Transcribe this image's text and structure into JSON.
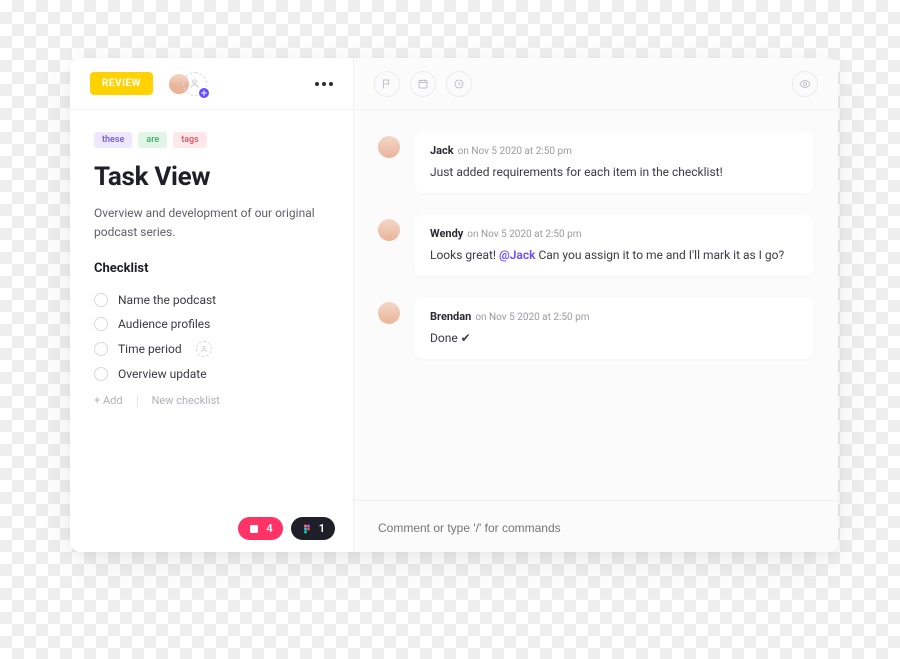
{
  "status_badge": "REVIEW",
  "tags": [
    {
      "label": "these",
      "bg": "#ede7ff",
      "fg": "#7a63d6"
    },
    {
      "label": "are",
      "bg": "#e2f6e8",
      "fg": "#4caf7a"
    },
    {
      "label": "tags",
      "bg": "#ffe7ea",
      "fg": "#e55a6a"
    }
  ],
  "title": "Task View",
  "description": "Overview and development of our original podcast series.",
  "checklist": {
    "heading": "Checklist",
    "items": [
      {
        "label": "Name the podcast",
        "hint_person": false
      },
      {
        "label": "Audience profiles",
        "hint_person": false
      },
      {
        "label": "Time period",
        "hint_person": true
      },
      {
        "label": "Overview update",
        "hint_person": false
      }
    ],
    "add_label": "+ Add",
    "new_checklist_label": "New checklist"
  },
  "attachments": [
    {
      "id": "invision",
      "count": 4,
      "bg": "#ff3366"
    },
    {
      "id": "figma",
      "count": 1,
      "bg": "#1f1f29"
    }
  ],
  "comments": [
    {
      "author": "Jack",
      "date_prefix": "on",
      "date": "Nov 5 2020 at 2:50 pm",
      "body_plain": "Just added requirements for each item in the checklist!"
    },
    {
      "author": "Wendy",
      "date_prefix": "on",
      "date": "Nov 5 2020 at 2:50 pm",
      "body_prefix": "Looks great! ",
      "mention": "@Jack",
      "body_suffix": " Can you assign it to me and I'll mark it as I go?"
    },
    {
      "author": "Brendan",
      "date_prefix": "on",
      "date": "Nov 5 2020 at 2:50 pm",
      "body_plain": "Done ✔"
    }
  ],
  "comment_placeholder": "Comment or type '/' for commands"
}
